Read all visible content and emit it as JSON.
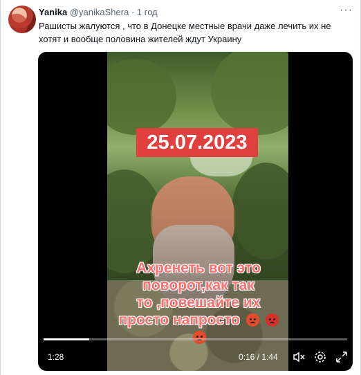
{
  "tweet": {
    "author_name": "Yanika",
    "author_handle": "@yanikaShera",
    "separator": "·",
    "time": "1 год",
    "more_label": "···",
    "text": "Рашисты жалуются , что в Донецке местные врачи даже лечить их не хотят и вообще половина жителей ждут Украину"
  },
  "video": {
    "date_overlay": "25.07.2023",
    "caption_lines": [
      "Ахренеть вот это",
      "поворот,как так",
      "то ,повешайте их",
      "просто напросто"
    ],
    "controls": {
      "left_label": "1:28",
      "elapsed": "0:16",
      "separator": "/",
      "duration": "1:44",
      "progress": 0.15
    }
  },
  "icons": [
    "mute-icon",
    "settings-icon",
    "fullscreen-icon",
    "emoji-angry-icon"
  ],
  "colors": {
    "date_bg": "#e0413f",
    "caption": "#ff6f6f",
    "text": "#0f1419",
    "muted": "#536471"
  }
}
